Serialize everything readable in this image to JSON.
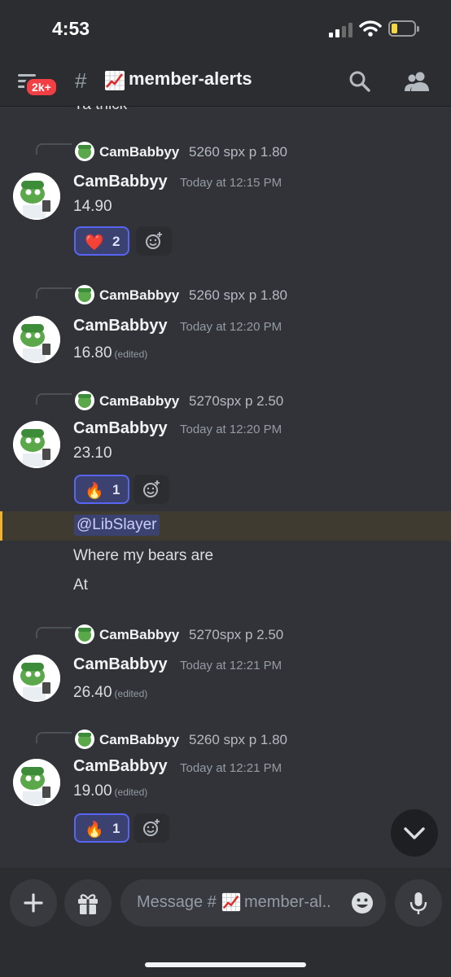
{
  "status": {
    "time": "4:53"
  },
  "header": {
    "badge": "2k+",
    "channel": "member-alerts",
    "channel_emoji": "chart-increasing-icon"
  },
  "top_clipped_text": "Ya thick",
  "messages": [
    {
      "reply_author": "CamBabbyy",
      "reply_text": "5260 spx p 1.80",
      "author": "CamBabbyy",
      "time": "Today at 12:15 PM",
      "text": "14.90",
      "edited": "",
      "reaction": {
        "emoji": "❤️",
        "count": "2"
      }
    },
    {
      "reply_author": "CamBabbyy",
      "reply_text": "5260 spx p 1.80",
      "author": "CamBabbyy",
      "time": "Today at 12:20 PM",
      "text": "16.80",
      "edited": "(edited)"
    },
    {
      "reply_author": "CamBabbyy",
      "reply_text": "5270spx p 2.50",
      "author": "CamBabbyy",
      "time": "Today at 12:20 PM",
      "text": "23.10",
      "edited": "",
      "reaction": {
        "emoji": "🔥",
        "count": "1"
      }
    },
    {
      "reply_author": "CamBabbyy",
      "reply_text": "5270spx p 2.50",
      "author": "CamBabbyy",
      "time": "Today at 12:21 PM",
      "text": "26.40",
      "edited": "(edited)"
    },
    {
      "reply_author": "CamBabbyy",
      "reply_text": "5260 spx p 1.80",
      "author": "CamBabbyy",
      "time": "Today at 12:21 PM",
      "text": "19.00",
      "edited": "(edited)",
      "reaction": {
        "emoji": "🔥",
        "count": "1"
      }
    }
  ],
  "mention_message": {
    "mention": "@LibSlayer",
    "lines": [
      "Where my bears are",
      "At"
    ]
  },
  "composer": {
    "placeholder_prefix": "Message #",
    "placeholder_rest": "member-al.."
  },
  "colors": {
    "background": "#313338",
    "header": "#2b2d31",
    "accent": "#5865f2",
    "mention_highlight": "#f0b232",
    "badge": "#f23f43"
  }
}
